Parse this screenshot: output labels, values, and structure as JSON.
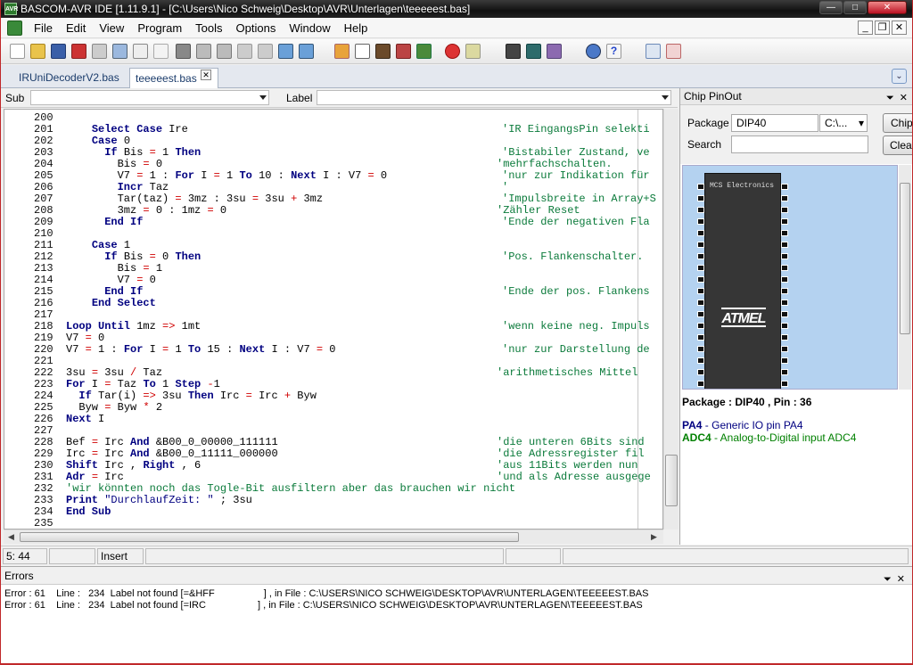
{
  "window": {
    "title": "BASCOM-AVR IDE [1.11.9.1] - [C:\\Users\\Nico Schweig\\Desktop\\AVR\\Unterlagen\\teeeeest.bas]",
    "app_icon_text": "AVR"
  },
  "menu": [
    "File",
    "Edit",
    "View",
    "Program",
    "Tools",
    "Options",
    "Window",
    "Help"
  ],
  "tabs": [
    {
      "label": "IRUniDecoderV2.bas",
      "active": false
    },
    {
      "label": "teeeeest.bas",
      "active": true
    }
  ],
  "subbar": {
    "sub_label": "Sub",
    "label_label": "Label"
  },
  "code_lines": [
    {
      "n": "200",
      "code": "",
      "comment": ""
    },
    {
      "n": "201",
      "code": "    <span class='kw'>Select Case</span> Ire",
      "comment": "'IR EingangsPin selekti"
    },
    {
      "n": "202",
      "code": "    <span class='kw'>Case</span> 0",
      "comment": ""
    },
    {
      "n": "203",
      "code": "      <span class='kw'>If</span> Bis <span class='op'>=</span> 1 <span class='kw'>Then</span>",
      "comment": "'Bistabiler Zustand, ve"
    },
    {
      "n": "204",
      "code": "        Bis <span class='op'>=</span> 0",
      "comment": "'mehrfachschalten."
    },
    {
      "n": "205",
      "code": "        V7 <span class='op'>=</span> 1 : <span class='kw'>For</span> I <span class='op'>=</span> 1 <span class='kw'>To</span> 10 : <span class='kw'>Next</span> I : V7 <span class='op'>=</span> 0",
      "comment": "'nur zur Indikation für"
    },
    {
      "n": "206",
      "code": "        <span class='kw'>Incr</span> Taz",
      "comment": "'"
    },
    {
      "n": "207",
      "code": "        Tar(taz) <span class='op'>=</span> 3mz : 3su <span class='op'>=</span> 3su <span class='op'>+</span> 3mz",
      "comment": "'Impulsbreite in Array+S"
    },
    {
      "n": "208",
      "code": "        3mz <span class='op'>=</span> 0 : 1mz <span class='op'>=</span> 0",
      "comment": "'Zähler Reset"
    },
    {
      "n": "209",
      "code": "      <span class='kw'>End If</span>",
      "comment": "'Ende der negativen Fla"
    },
    {
      "n": "210",
      "code": "",
      "comment": ""
    },
    {
      "n": "211",
      "code": "    <span class='kw'>Case</span> 1",
      "comment": ""
    },
    {
      "n": "212",
      "code": "      <span class='kw'>If</span> Bis <span class='op'>=</span> 0 <span class='kw'>Then</span>",
      "comment": "'Pos. Flankenschalter."
    },
    {
      "n": "213",
      "code": "        Bis <span class='op'>=</span> 1",
      "comment": ""
    },
    {
      "n": "214",
      "code": "        V7 <span class='op'>=</span> 0",
      "comment": ""
    },
    {
      "n": "215",
      "code": "      <span class='kw'>End If</span>",
      "comment": "'Ende der pos. Flankens"
    },
    {
      "n": "216",
      "code": "    <span class='kw'>End Select</span>",
      "comment": ""
    },
    {
      "n": "217",
      "code": "",
      "comment": ""
    },
    {
      "n": "218",
      "code": "<span class='kw'>Loop Until</span> 1mz <span class='op'>=&gt;</span> 1mt",
      "comment": "'wenn keine neg. Impuls"
    },
    {
      "n": "219",
      "code": "V7 <span class='op'>=</span> 0",
      "comment": ""
    },
    {
      "n": "220",
      "code": "V7 <span class='op'>=</span> 1 : <span class='kw'>For</span> I <span class='op'>=</span> 1 <span class='kw'>To</span> 15 : <span class='kw'>Next</span> I : V7 <span class='op'>=</span> 0",
      "comment": "'nur zur Darstellung de"
    },
    {
      "n": "221",
      "code": "",
      "comment": ""
    },
    {
      "n": "222",
      "code": "3su <span class='op'>=</span> 3su <span class='op'>/</span> Taz",
      "comment": "'arithmetisches Mittel"
    },
    {
      "n": "223",
      "code": "<span class='kw'>For</span> I <span class='op'>=</span> Taz <span class='kw'>To</span> 1 <span class='kw'>Step</span> <span class='op'>-</span>1",
      "comment": ""
    },
    {
      "n": "224",
      "code": "  <span class='kw'>If</span> Tar(i) <span class='op'>=&gt;</span> 3su <span class='kw'>Then</span> Irc <span class='op'>=</span> Irc <span class='op'>+</span> Byw",
      "comment": ""
    },
    {
      "n": "225",
      "code": "  Byw <span class='op'>=</span> Byw <span class='op'>*</span> 2",
      "comment": ""
    },
    {
      "n": "226",
      "code": "<span class='kw'>Next</span> I",
      "comment": ""
    },
    {
      "n": "227",
      "code": "",
      "comment": ""
    },
    {
      "n": "228",
      "code": "Bef <span class='op'>=</span> Irc <span class='kw'>And</span> &amp;B00_0_00000_111111",
      "comment": "'die unteren 6Bits sind"
    },
    {
      "n": "229",
      "code": "Irc <span class='op'>=</span> Irc <span class='kw'>And</span> &amp;B00_0_11111_000000",
      "comment": "'die Adressregister fil"
    },
    {
      "n": "230",
      "code": "<span class='kw'>Shift</span> Irc , <span class='kw'>Right</span> , 6",
      "comment": "'aus 11Bits werden nun"
    },
    {
      "n": "231",
      "code": "<span class='kw'>Adr</span> <span class='op'>=</span> Irc",
      "comment": "'und als Adresse ausgege"
    },
    {
      "n": "232",
      "code": "<span style='color:#0a7a3a'>'wir könnten noch das Togle-Bit ausfiltern aber das brauchen wir nicht</span>",
      "comment": ""
    },
    {
      "n": "233",
      "code": "<span class='kw'>Print</span> <span class='str'>\"DurchlaufZeit: \"</span> ; 3su",
      "comment": ""
    },
    {
      "n": "234",
      "code": "<span class='kw'>End Sub</span>",
      "comment": ""
    },
    {
      "n": "235",
      "code": "",
      "comment": ""
    }
  ],
  "status": {
    "position": "5: 44",
    "mode": "Insert"
  },
  "chip_pinout": {
    "title": "Chip PinOut",
    "package_label": "Package",
    "package_value": "DIP40",
    "path_value": "C:\\...",
    "search_label": "Search",
    "search_value": "",
    "chip_button": "Chip",
    "clear_button": "Clear",
    "chip_text": "MCS Electronics",
    "logo_text": "ATMEL",
    "package_info": "Package : DIP40 , Pin : 36",
    "pin_name": "PA4",
    "pin_desc": " - Generic IO pin PA4",
    "adc_name": "ADC4",
    "adc_desc": " - Analog-to-Digital input ADC4",
    "colors": {
      "pin": "#000080",
      "adc": "#008000"
    }
  },
  "errors": {
    "title": "Errors",
    "lines": [
      "Error : 61    Line :   234  Label not found [=&HFF                  ] , in File : C:\\USERS\\NICO SCHWEIG\\DESKTOP\\AVR\\UNTERLAGEN\\TEEEEEST.BAS",
      "Error : 61    Line :   234  Label not found [=IRC                   ] , in File : C:\\USERS\\NICO SCHWEIG\\DESKTOP\\AVR\\UNTERLAGEN\\TEEEEEST.BAS"
    ]
  }
}
